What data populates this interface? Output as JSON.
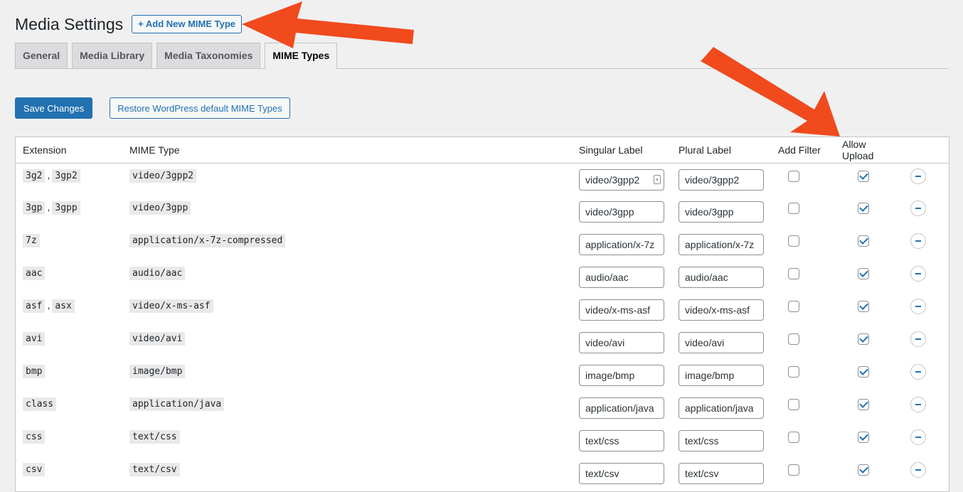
{
  "header": {
    "title": "Media Settings",
    "add_new_label": "+ Add New MIME Type"
  },
  "tabs": [
    {
      "label": "General",
      "active": false
    },
    {
      "label": "Media Library",
      "active": false
    },
    {
      "label": "Media Taxonomies",
      "active": false
    },
    {
      "label": "MIME Types",
      "active": true
    }
  ],
  "actions": {
    "save_label": "Save Changes",
    "restore_label": "Restore WordPress default MIME Types"
  },
  "table": {
    "columns": [
      "Extension",
      "MIME Type",
      "Singular Label",
      "Plural Label",
      "Add Filter",
      "Allow Upload"
    ],
    "rows": [
      {
        "extensions": [
          "3g2",
          "3gp2"
        ],
        "mime": "video/3gpp2",
        "singular": "video/3gpp2",
        "plural": "video/3gpp2",
        "add_filter": false,
        "allow_upload": true
      },
      {
        "extensions": [
          "3gp",
          "3gpp"
        ],
        "mime": "video/3gpp",
        "singular": "video/3gpp",
        "plural": "video/3gpp",
        "add_filter": false,
        "allow_upload": true
      },
      {
        "extensions": [
          "7z"
        ],
        "mime": "application/x-7z-compressed",
        "singular": "application/x-7z",
        "plural": "application/x-7z",
        "add_filter": false,
        "allow_upload": true
      },
      {
        "extensions": [
          "aac"
        ],
        "mime": "audio/aac",
        "singular": "audio/aac",
        "plural": "audio/aac",
        "add_filter": false,
        "allow_upload": true
      },
      {
        "extensions": [
          "asf",
          "asx"
        ],
        "mime": "video/x-ms-asf",
        "singular": "video/x-ms-asf",
        "plural": "video/x-ms-asf",
        "add_filter": false,
        "allow_upload": true
      },
      {
        "extensions": [
          "avi"
        ],
        "mime": "video/avi",
        "singular": "video/avi",
        "plural": "video/avi",
        "add_filter": false,
        "allow_upload": true
      },
      {
        "extensions": [
          "bmp"
        ],
        "mime": "image/bmp",
        "singular": "image/bmp",
        "plural": "image/bmp",
        "add_filter": false,
        "allow_upload": true
      },
      {
        "extensions": [
          "class"
        ],
        "mime": "application/java",
        "singular": "application/java",
        "plural": "application/java",
        "add_filter": false,
        "allow_upload": true
      },
      {
        "extensions": [
          "css"
        ],
        "mime": "text/css",
        "singular": "text/css",
        "plural": "text/css",
        "add_filter": false,
        "allow_upload": true
      },
      {
        "extensions": [
          "csv"
        ],
        "mime": "text/csv",
        "singular": "text/csv",
        "plural": "text/csv",
        "add_filter": false,
        "allow_upload": true
      }
    ]
  },
  "annotation_color": "#f04a1d"
}
